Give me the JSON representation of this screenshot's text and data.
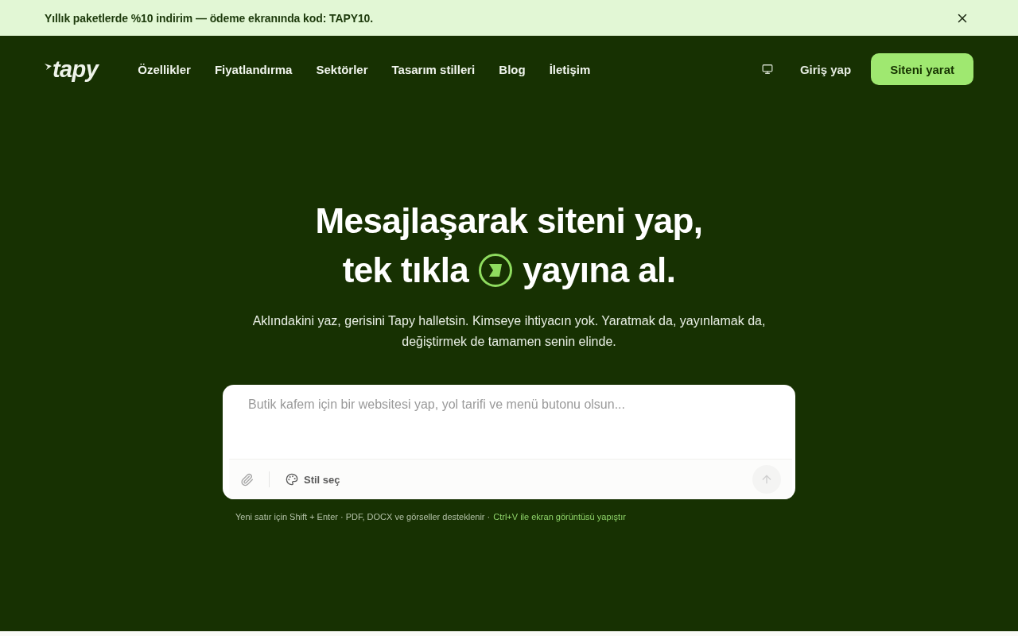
{
  "announcement": {
    "text": "Yıllık paketlerde %10 indirim — ödeme ekranında kod: TAPY10."
  },
  "header": {
    "logo": "tapy",
    "nav": [
      "Özellikler",
      "Fiyatlandırma",
      "Sektörler",
      "Tasarım stilleri",
      "Blog",
      "İletişim"
    ],
    "login": "Giriş yap",
    "cta": "Siteni yarat"
  },
  "hero": {
    "headline_line_1": "Mesajlaşarak siteni yap,",
    "headline_line_2_before": "tek tıkla",
    "headline_line_2_after": "yayına al.",
    "subtitle": "Aklındakini yaz, gerisini Tapy halletsin. Kimseye ihtiyacın yok. Yaratmak da, yayınlamak da, değiştirmek de tamamen senin elinde."
  },
  "composer": {
    "placeholder": "Butik kafem için bir websitesi yap, yol tarifi ve menü butonu olsun...",
    "style_button": "Stil seç",
    "send_button": {
      "disabled": true
    }
  },
  "hints": [
    {
      "text": "Yeni satır için Shift + Enter · PDF, DOCX ve görseller desteklenir ·",
      "highlight": false
    },
    {
      "text": "Ctrl+V ile ekran görüntüsü yapıştır",
      "highlight": true
    }
  ]
}
